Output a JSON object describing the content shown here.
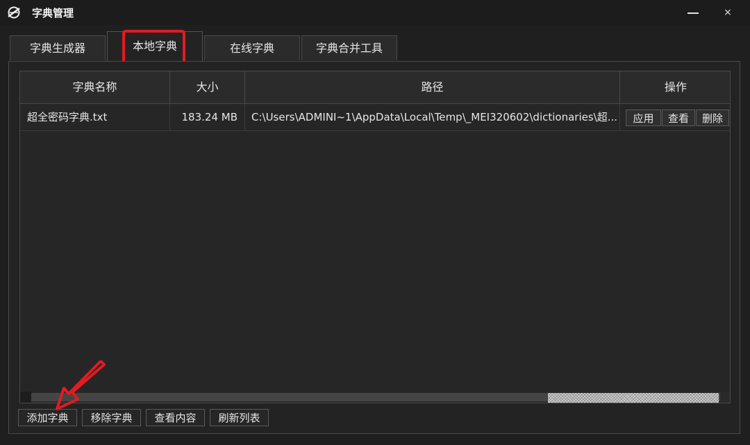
{
  "window": {
    "title": "字典管理",
    "minimize_icon": "minimize-icon",
    "close_label": "×"
  },
  "tabs": [
    {
      "label": "字典生成器",
      "active": false
    },
    {
      "label": "本地字典",
      "active": true
    },
    {
      "label": "在线字典",
      "active": false
    },
    {
      "label": "字典合并工具",
      "active": false
    }
  ],
  "table": {
    "columns": [
      "字典名称",
      "大小",
      "路径",
      "操作"
    ],
    "rows": [
      {
        "name": "超全密码字典.txt",
        "size": "183.24 MB",
        "path": "C:\\Users\\ADMINI~1\\AppData\\Local\\Temp\\_MEI320602\\dictionaries\\超...",
        "actions": [
          "应用",
          "查看",
          "删除"
        ]
      }
    ]
  },
  "bottom_buttons": [
    "添加字典",
    "移除字典",
    "查看内容",
    "刷新列表"
  ],
  "colors": {
    "highlight": "#e21b22",
    "background": "#1f1f1f"
  }
}
